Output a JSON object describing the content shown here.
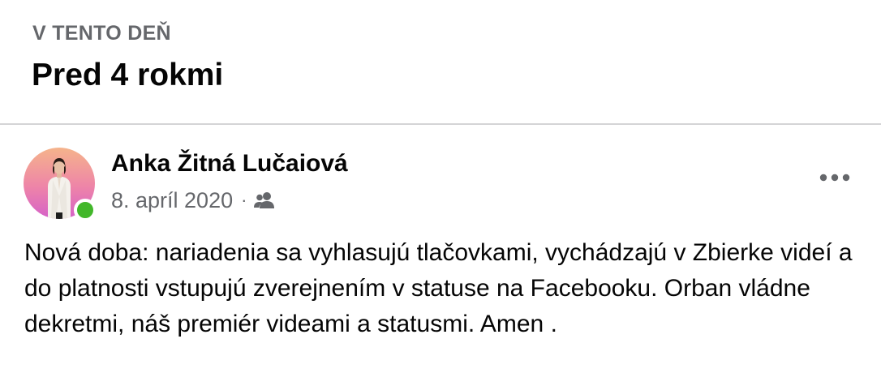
{
  "memory": {
    "section_label": "V TENTO DEŇ",
    "title": "Pred 4 rokmi"
  },
  "post": {
    "author": "Anka Žitná Lučaiová",
    "date": "8. apríl 2020",
    "separator": "·",
    "audience_icon": "friends-icon",
    "more_icon": "more-options-icon",
    "text": "Nová doba: nariadenia sa vyhlasujú tlačovkami, vychádzajú v Zbierke videí a do platnosti vstupujú zverejnením v statuse na Facebooku. Orban vládne dekretmi, náš premiér videami a statusmi. Amen ."
  },
  "colors": {
    "primary_text": "#050505",
    "secondary_text": "#65676b",
    "divider": "#d4d4d6",
    "online": "#42b72a"
  }
}
